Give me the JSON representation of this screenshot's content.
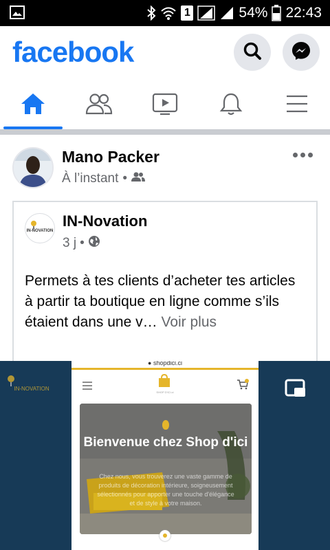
{
  "status_bar": {
    "battery_percent": "54%",
    "time": "22:43",
    "sim_label": "1",
    "icons": [
      "image-icon",
      "bluetooth-icon",
      "wifi-icon",
      "signal-icon",
      "battery-icon"
    ]
  },
  "header": {
    "logo": "facebook",
    "search_icon": "search-icon",
    "messenger_icon": "messenger-icon",
    "brand_color": "#1877f2"
  },
  "tabs": [
    {
      "name": "home",
      "icon": "home-icon",
      "active": true
    },
    {
      "name": "friends",
      "icon": "friends-icon",
      "active": false
    },
    {
      "name": "watch",
      "icon": "video-icon",
      "active": false
    },
    {
      "name": "notifications",
      "icon": "bell-icon",
      "active": false
    },
    {
      "name": "menu",
      "icon": "menu-icon",
      "active": false
    }
  ],
  "post": {
    "author": "Mano Packer",
    "time": "À l’instant",
    "privacy_icon": "friends-icon",
    "shared": {
      "page_name": "IN-Novation",
      "time": "3 j",
      "privacy_icon": "globe-icon",
      "logo_text": "IN-NOVATION",
      "text": "Permets à tes clients d’acheter tes articles à partir ta boutique en ligne comme s’ils étaient dans une v…",
      "see_more": "Voir plus"
    }
  },
  "video": {
    "url": "shopdici.ci",
    "watermark_text": "IN-NOVATION",
    "site_logo_text": "SHOP D'ICI.ci",
    "hero_title": "Bienvenue chez Shop d'ici",
    "hero_subtitle": "Chez nous, vous trouverez une vaste gamme de produits de décoration intérieure, soigneusement sélectionnés pour apporter une touche d'élégance et de style à votre maison.",
    "bg_color": "#173a57",
    "accent_color": "#e5b52b"
  }
}
